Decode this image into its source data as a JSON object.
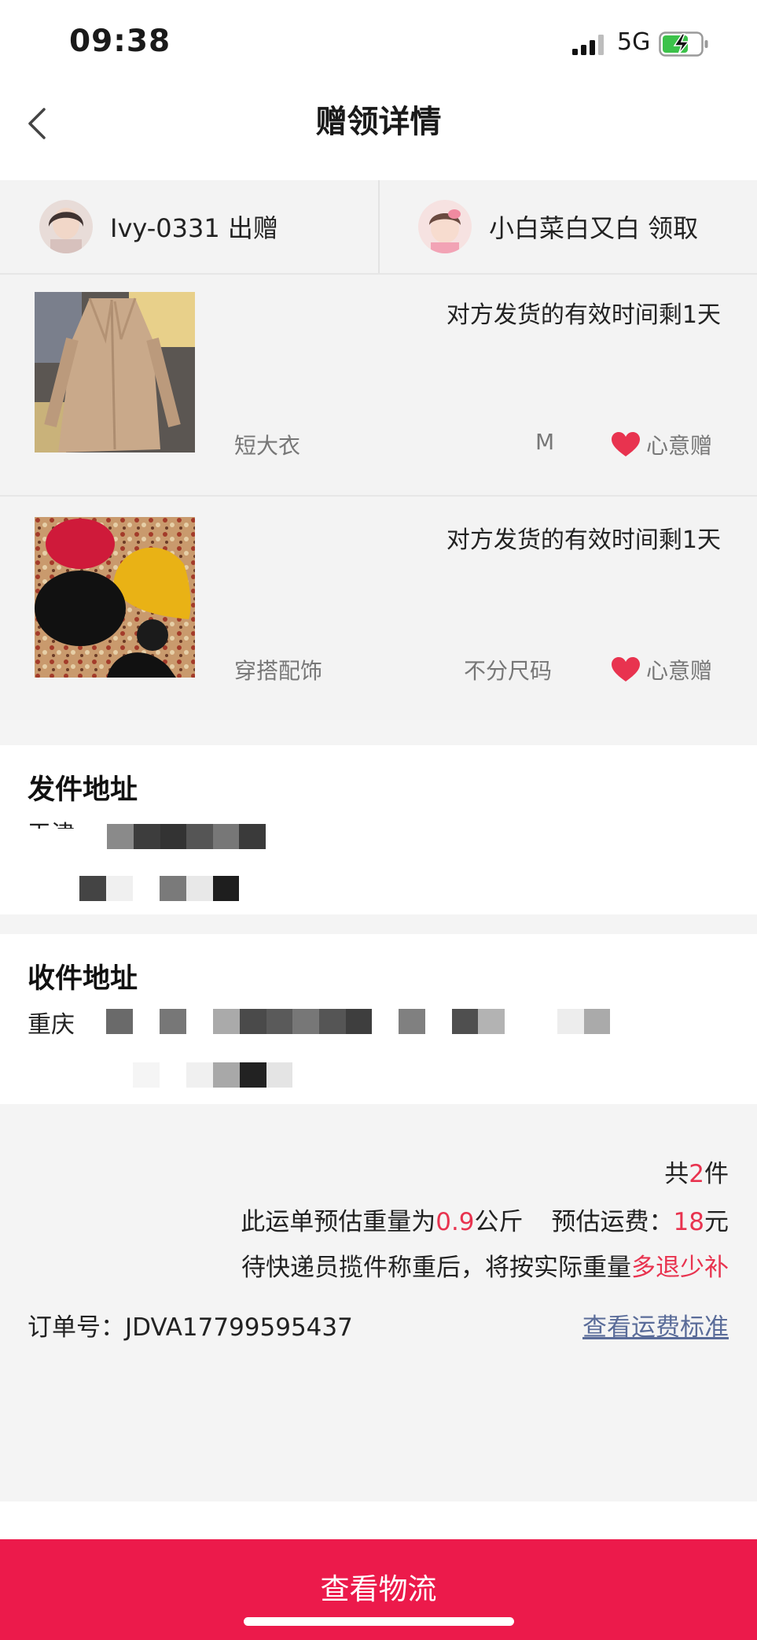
{
  "status_bar": {
    "time": "09:38",
    "network": "5G",
    "icons": [
      "signal-icon",
      "battery-charging-icon"
    ]
  },
  "nav": {
    "title": "赠领详情",
    "back_icon": "chevron-left-icon"
  },
  "participants": {
    "giver": {
      "name": "Ivy-0331 出赠"
    },
    "receiver": {
      "name": "小白菜白又白 领取"
    }
  },
  "items": [
    {
      "deadline": "对方发货的有效时间剩1天",
      "name": "短大衣",
      "size": "M",
      "tag": "心意赠"
    },
    {
      "deadline": "对方发货的有效时间剩1天",
      "name": "穿搭配饰",
      "size": "不分尺码",
      "tag": "心意赠"
    }
  ],
  "sender_address": {
    "title": "发件地址",
    "line1": "天津"
  },
  "receiver_address": {
    "title": "收件地址",
    "line1": "重庆"
  },
  "summary": {
    "count_prefix": "共",
    "count": "2",
    "count_suffix": "件",
    "weight_prefix": "此运单预估重量为",
    "weight": "0.9",
    "weight_unit": "公斤",
    "fee_prefix": "预估运费：",
    "fee": "18",
    "fee_unit": "元",
    "note_prefix": "待快递员揽件称重后，将按实际重量",
    "note_highlight": "多退少补",
    "order_label": "订单号：",
    "order_number": "JDVA17799595437",
    "freight_link": "查看运费标准"
  },
  "bottom": {
    "logistics_button": "查看物流"
  },
  "colors": {
    "accent": "#ec1a4b",
    "highlight": "#e8334f",
    "link": "#5a6c99",
    "heart": "#e8334f"
  }
}
